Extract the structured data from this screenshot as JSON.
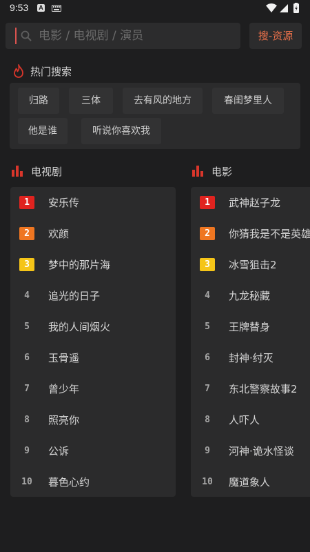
{
  "status_bar": {
    "time": "9:53",
    "notif_letter": "A"
  },
  "search": {
    "placeholder": "电影 / 电视剧 / 演员",
    "value": "",
    "button_label": "搜-资源"
  },
  "hot_search": {
    "title": "热门搜索",
    "chips": [
      "归路",
      "三体",
      "去有风的地方",
      "春闺梦里人",
      "他是谁",
      "听说你喜欢我"
    ]
  },
  "tv": {
    "title": "电视剧",
    "items": [
      {
        "rank": "1",
        "name": "安乐传"
      },
      {
        "rank": "2",
        "name": "欢颜"
      },
      {
        "rank": "3",
        "name": "梦中的那片海"
      },
      {
        "rank": "4",
        "name": "追光的日子"
      },
      {
        "rank": "5",
        "name": "我的人间烟火"
      },
      {
        "rank": "6",
        "name": "玉骨遥"
      },
      {
        "rank": "7",
        "name": "曾少年"
      },
      {
        "rank": "8",
        "name": "照亮你"
      },
      {
        "rank": "9",
        "name": "公诉"
      },
      {
        "rank": "10",
        "name": "暮色心约"
      }
    ]
  },
  "movie": {
    "title": "电影",
    "items": [
      {
        "rank": "1",
        "name": "武神赵子龙"
      },
      {
        "rank": "2",
        "name": "你猜我是不是英雄"
      },
      {
        "rank": "3",
        "name": "冰雪狙击2"
      },
      {
        "rank": "4",
        "name": "九龙秘藏"
      },
      {
        "rank": "5",
        "name": "王牌替身"
      },
      {
        "rank": "6",
        "name": "封神·纣灭"
      },
      {
        "rank": "7",
        "name": "东北警察故事2"
      },
      {
        "rank": "8",
        "name": "人吓人"
      },
      {
        "rank": "9",
        "name": "河神·诡水怪谈"
      },
      {
        "rank": "10",
        "name": "魔道象人"
      }
    ]
  },
  "colors": {
    "accent": "#e8704a",
    "rank1": "#e0231f",
    "rank2": "#ef7621",
    "rank3": "#f5c518",
    "icon_red": "#d9362b"
  }
}
